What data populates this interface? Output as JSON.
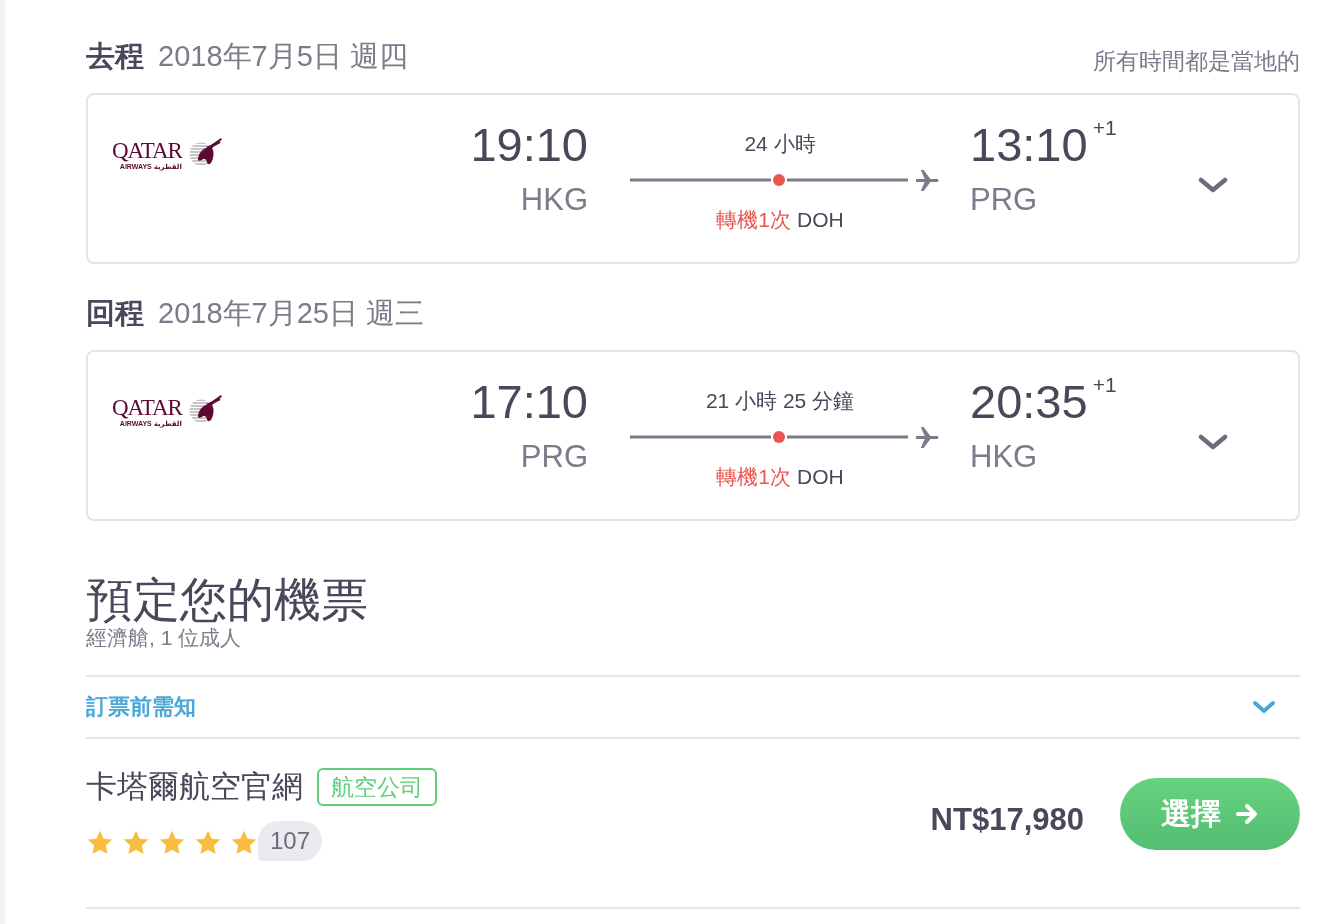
{
  "local_time_note": "所有時間都是當地的",
  "legs": [
    {
      "direction": "去程",
      "date": "2018年7月5日 週四",
      "airline_logo": {
        "wordmark": "QATAR",
        "subtitle": "AIRWAYS القطرية"
      },
      "departure": {
        "time": "19:10",
        "airport": "HKG"
      },
      "duration": "24 小時",
      "stops": "轉機1次",
      "stop_airport": "DOH",
      "arrival": {
        "time": "13:10",
        "day_offset": "+1",
        "airport": "PRG"
      },
      "expanded": false
    },
    {
      "direction": "回程",
      "date": "2018年7月25日 週三",
      "airline_logo": {
        "wordmark": "QATAR",
        "subtitle": "AIRWAYS القطرية"
      },
      "departure": {
        "time": "17:10",
        "airport": "PRG"
      },
      "duration": "21 小時 25 分鐘",
      "stops": "轉機1次",
      "stop_airport": "DOH",
      "arrival": {
        "time": "20:35",
        "day_offset": "+1",
        "airport": "HKG"
      },
      "expanded": false
    }
  ],
  "booking": {
    "title": "預定您的機票",
    "subtitle": "經濟艙, 1 位成人",
    "notice": {
      "label": "訂票前需知",
      "expanded": false
    },
    "offers": [
      {
        "provider": "卡塔爾航空官網",
        "tag": "航空公司",
        "stars": 5,
        "reviews": "107",
        "price": "NT$17,980",
        "button": "選擇"
      }
    ]
  }
}
